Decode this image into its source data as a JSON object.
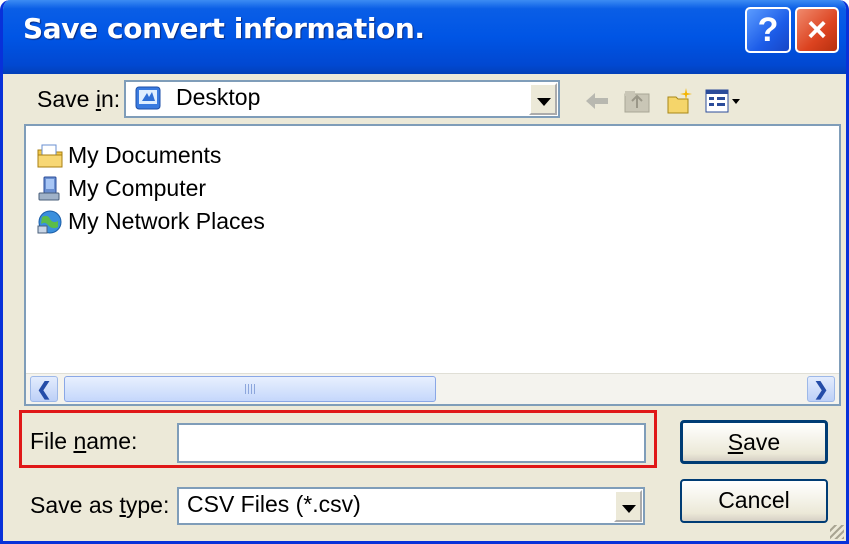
{
  "window": {
    "title": "Save convert information."
  },
  "title_buttons": {
    "help": "?",
    "close": "×"
  },
  "save_in": {
    "label_pre": "Save ",
    "label_u": "i",
    "label_post": "n:",
    "value": "Desktop"
  },
  "file_list": {
    "items": [
      {
        "name": "My Documents",
        "icon": "my-documents-icon"
      },
      {
        "name": "My Computer",
        "icon": "my-computer-icon"
      },
      {
        "name": "My Network Places",
        "icon": "my-network-places-icon"
      }
    ]
  },
  "file_name": {
    "label_pre": "File ",
    "label_u": "n",
    "label_post": "ame:",
    "value": ""
  },
  "save_as_type": {
    "label_pre": "Save as ",
    "label_u": "t",
    "label_post": "ype:",
    "value": "CSV Files (*.csv)"
  },
  "buttons": {
    "save_u": "S",
    "save_post": "ave",
    "cancel": "Cancel"
  },
  "colors": {
    "titlebar": "#0055e5",
    "dialog_bg": "#ece9d8",
    "highlight_box": "#e01818"
  }
}
